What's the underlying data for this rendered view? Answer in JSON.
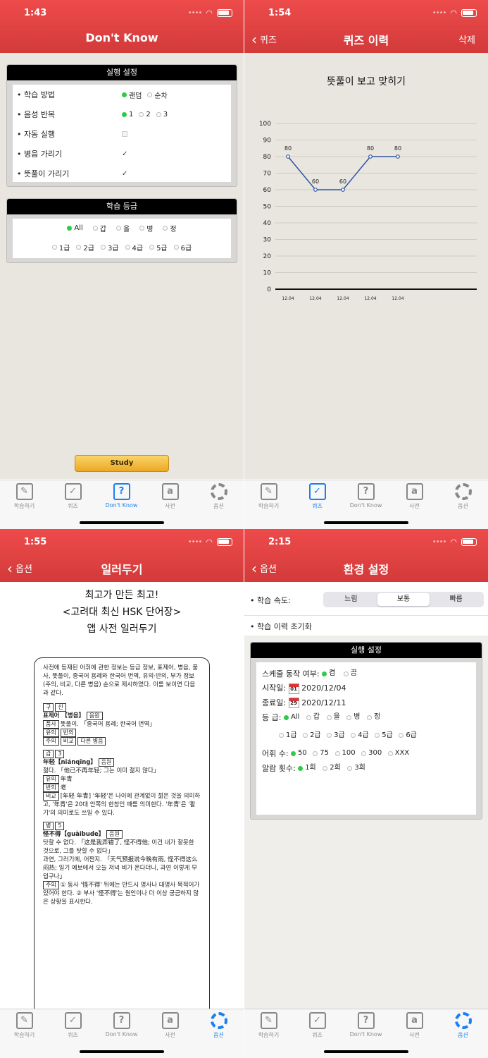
{
  "statusbar": {
    "s1_time": "1:43",
    "s2_time": "1:54",
    "s3_time": "1:55",
    "s4_time": "2:15"
  },
  "tabs": [
    "학습하기",
    "퀴즈",
    "Don't Know",
    "사전",
    "옵션"
  ],
  "screen1": {
    "title": "Don't Know",
    "panel1": {
      "header": "실행 설정",
      "rows": [
        {
          "label": "• 학습 방법",
          "options": [
            "랜덤",
            "순차"
          ],
          "selected": 0
        },
        {
          "label": "• 음성 반복",
          "options": [
            "1",
            "2",
            "3"
          ],
          "selected": 0
        },
        {
          "label": "• 자동 실행",
          "checked": false
        },
        {
          "label": "• 병음 가리기",
          "checked": true
        },
        {
          "label": "• 뜻풀이 가리기",
          "checked": true
        }
      ]
    },
    "panel2": {
      "header": "학습 등급",
      "row1": [
        "All",
        "갑",
        "을",
        "병",
        "정"
      ],
      "row1_selected": 0,
      "row2": [
        "1급",
        "2급",
        "3급",
        "4급",
        "5급",
        "6급"
      ]
    },
    "study_label": "Study",
    "active_tab": 2
  },
  "screen2": {
    "back": "퀴즈",
    "title": "퀴즈 이력",
    "right": "삭제",
    "active_tab": 1,
    "chart_data": {
      "type": "line",
      "title": "뜻풀이 보고 맞히기",
      "categories": [
        "12.04",
        "12.04",
        "12.04",
        "12.04",
        "12.04"
      ],
      "values": [
        80,
        60,
        60,
        80,
        80
      ],
      "ylim": [
        0,
        100
      ],
      "yticks": [
        0,
        10,
        20,
        30,
        40,
        50,
        60,
        70,
        80,
        90,
        100
      ],
      "grid": true,
      "color": "#2e55a0"
    }
  },
  "screen3": {
    "back": "옵션",
    "title": "일러두기",
    "heading": [
      "최고가 만든 최고!",
      "<고려대 최신 HSK 단어장>",
      "앱 사전 일러두기"
    ],
    "intro": "사전에 등재된 어휘에 관한 정보는 등급 정보, 표제어, 병음, 품사, 뜻풀이, 중국어 용례와 한국어 번역, 유의·반의, 부가 정보(주의, 비교, 다른 병음) 순으로 제시하였다. 이를 보이면 다음과 같다.",
    "entry1": {
      "grade": [
        "구",
        "신"
      ],
      "head": "표제어 【병음】",
      "sound": "음원",
      "pos": "품사",
      "pos_text": "뜻풀이. 「중국어 용례; 한국어 번역」",
      "tags": [
        "유의",
        "반의"
      ],
      "tags2": [
        "주의",
        "비교",
        "다른 병음"
      ]
    },
    "entry2": {
      "grade": [
        "갑",
        "3"
      ],
      "head": "年轻【niánqīng】",
      "sound": "음원",
      "def": "젊다. 「他已不再年轻; 그는 이미 젊지 않다」",
      "syn_label": "유의",
      "syn": "年青",
      "ant_label": "반의",
      "ant": "老",
      "cmp_label": "비교",
      "cmp": "[年轻 年青] '年轻'은 나이에 관계없이 젊은 것을 의미하고, '年青'은 20대 안쪽의 한창인 때를 의미한다. '年青'은 '활기'의 의미로도 쓰일 수 있다."
    },
    "entry3": {
      "grade": [
        "병",
        "5"
      ],
      "head": "怪不得【guàibude】",
      "sound": "음원",
      "def1": "탓할 수 없다. 「这是我弄错了, 怪不得他; 이건 내가 잘못한 것으로, 그를 탓할 수 없다」",
      "def2": "과연, 그러기에, 어쩐지. 「天气预报说今晚有雨, 怪不得这么闷热; 일기 예보에서 오늘 저녁 비가 온다더니, 과연 이렇게 무덥구나」",
      "note_label": "주의",
      "note": "① 동사 '怪不得' 뒤에는 반드시 명사나 대명사 목적어가 있어야 한다. ② 부사 '怪不得'는 원인이나 더 이상 궁금하지 않은 상황을 표시한다."
    },
    "active_tab": 4
  },
  "screen4": {
    "back": "옵션",
    "title": "환경 설정",
    "speed_label": "• 학습 속도:",
    "speed_options": [
      "느림",
      "보통",
      "빠름"
    ],
    "speed_selected": 1,
    "reset_label": "• 학습 이력 초기화",
    "panel": {
      "header": "실행 설정",
      "schedule_label": "스케줄 동작 여부:",
      "schedule_options": [
        "켬",
        "끔"
      ],
      "start_label": "시작일:",
      "start_day": "01",
      "start_date": "2020/12/04",
      "end_label": "종료일:",
      "end_day": "29",
      "end_date": "2020/12/11",
      "grade_label": "등 급:",
      "grade_row1": [
        "All",
        "갑",
        "을",
        "병",
        "정"
      ],
      "grade_row2": [
        "1급",
        "2급",
        "3급",
        "4급",
        "5급",
        "6급"
      ],
      "vocab_label": "어휘 수:",
      "vocab_options": [
        "50",
        "75",
        "100",
        "300",
        "XXX"
      ],
      "alarm_label": "알람 횟수:",
      "alarm_options": [
        "1회",
        "2회",
        "3회"
      ]
    },
    "active_tab": 4
  }
}
